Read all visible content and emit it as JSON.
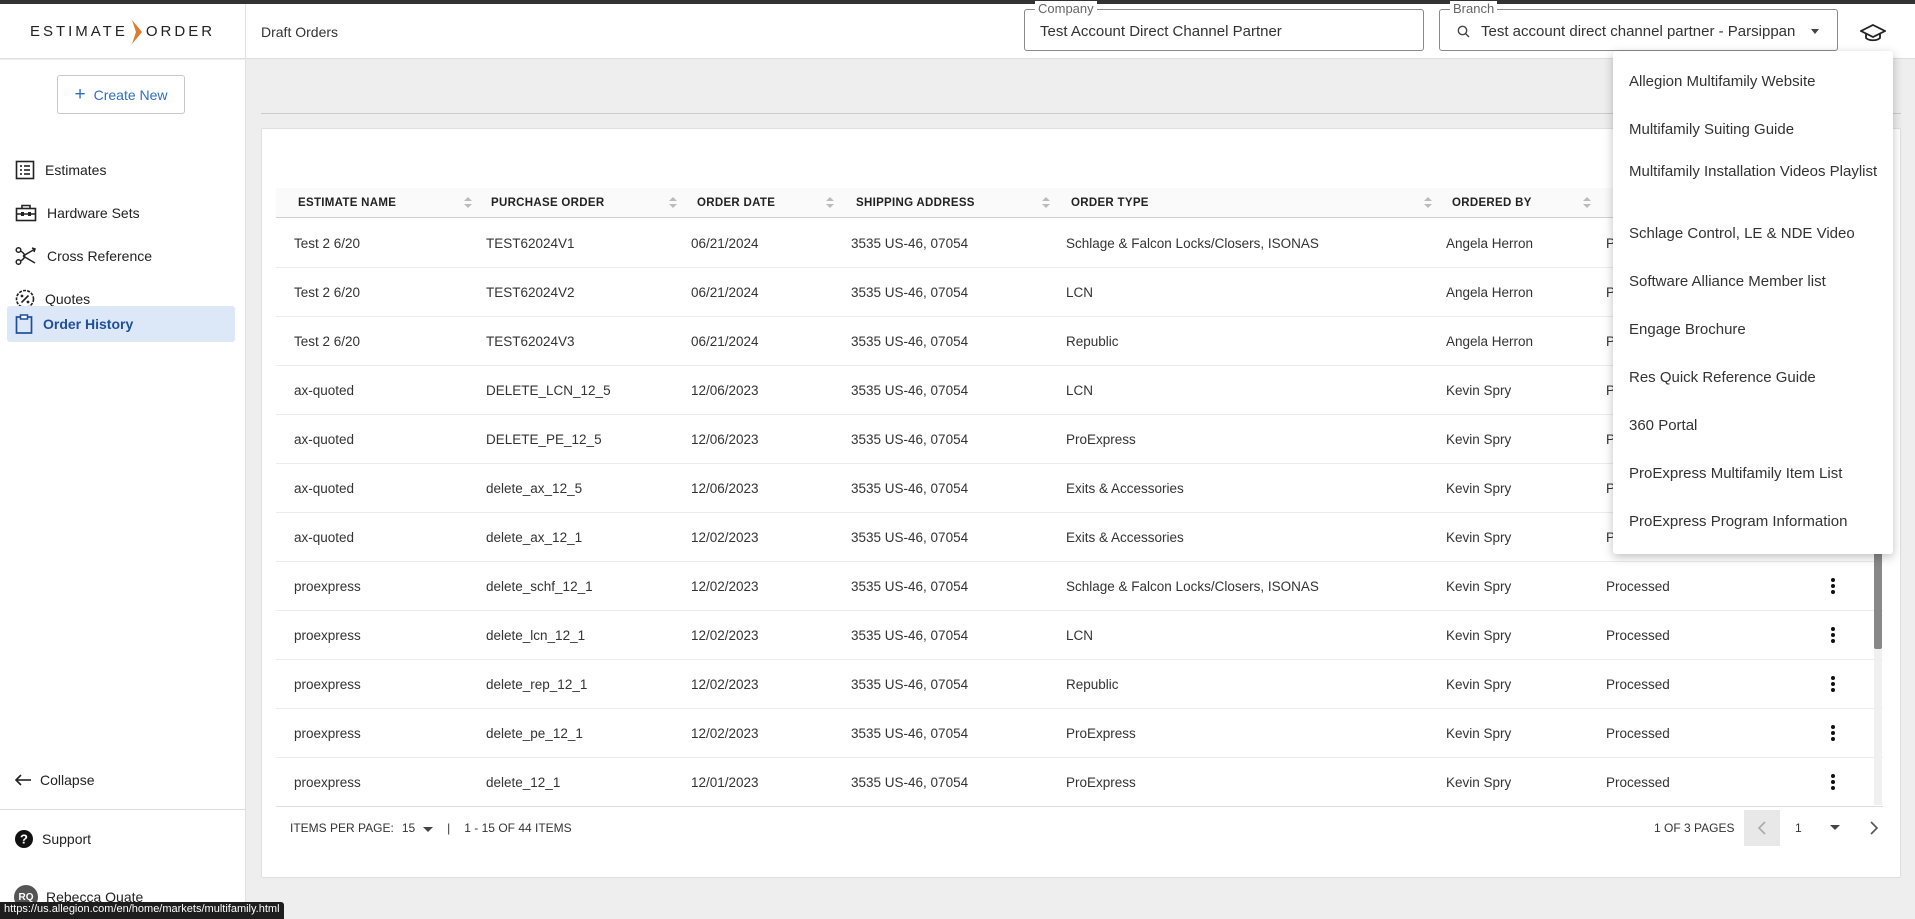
{
  "header": {
    "logo_left": "ESTIMATE",
    "logo_right": "ORDER",
    "page_title": "Draft Orders",
    "company": {
      "label": "Company",
      "value": "Test Account Direct Channel Partner"
    },
    "branch": {
      "label": "Branch",
      "value": "Test account direct channel partner - Parsippany"
    }
  },
  "sidebar": {
    "create_label": "Create New",
    "items": [
      {
        "label": "Estimates",
        "icon": "list-icon"
      },
      {
        "label": "Hardware Sets",
        "icon": "toolbox-icon"
      },
      {
        "label": "Cross Reference",
        "icon": "cross-reference-icon"
      },
      {
        "label": "Quotes",
        "icon": "percent-badge-icon"
      },
      {
        "label": "Order History",
        "icon": "clipboard-icon",
        "active": true
      }
    ],
    "collapse_label": "Collapse",
    "support_label": "Support",
    "user_initials": "RQ",
    "user_name": "Rebecca Quate"
  },
  "table": {
    "columns": [
      "ESTIMATE NAME",
      "PURCHASE ORDER",
      "ORDER DATE",
      "SHIPPING ADDRESS",
      "ORDER TYPE",
      "ORDERED BY"
    ],
    "rows": [
      [
        "Test 2 6/20",
        "TEST62024V1",
        "06/21/2024",
        "3535 US-46, 07054",
        "Schlage & Falcon Locks/Closers, ISONAS",
        "Angela Herron",
        "P"
      ],
      [
        "Test 2 6/20",
        "TEST62024V2",
        "06/21/2024",
        "3535 US-46, 07054",
        "LCN",
        "Angela Herron",
        "P"
      ],
      [
        "Test 2 6/20",
        "TEST62024V3",
        "06/21/2024",
        "3535 US-46, 07054",
        "Republic",
        "Angela Herron",
        "P"
      ],
      [
        "ax-quoted",
        "DELETE_LCN_12_5",
        "12/06/2023",
        "3535 US-46, 07054",
        "LCN",
        "Kevin Spry",
        "P"
      ],
      [
        "ax-quoted",
        "DELETE_PE_12_5",
        "12/06/2023",
        "3535 US-46, 07054",
        "ProExpress",
        "Kevin Spry",
        "P"
      ],
      [
        "ax-quoted",
        "delete_ax_12_5",
        "12/06/2023",
        "3535 US-46, 07054",
        "Exits & Accessories",
        "Kevin Spry",
        "P"
      ],
      [
        "ax-quoted",
        "delete_ax_12_1",
        "12/02/2023",
        "3535 US-46, 07054",
        "Exits & Accessories",
        "Kevin Spry",
        "P"
      ],
      [
        "proexpress",
        "delete_schf_12_1",
        "12/02/2023",
        "3535 US-46, 07054",
        "Schlage & Falcon Locks/Closers, ISONAS",
        "Kevin Spry",
        "Processed"
      ],
      [
        "proexpress",
        "delete_lcn_12_1",
        "12/02/2023",
        "3535 US-46, 07054",
        "LCN",
        "Kevin Spry",
        "Processed"
      ],
      [
        "proexpress",
        "delete_rep_12_1",
        "12/02/2023",
        "3535 US-46, 07054",
        "Republic",
        "Kevin Spry",
        "Processed"
      ],
      [
        "proexpress",
        "delete_pe_12_1",
        "12/02/2023",
        "3535 US-46, 07054",
        "ProExpress",
        "Kevin Spry",
        "Processed"
      ],
      [
        "proexpress",
        "delete_12_1",
        "12/01/2023",
        "3535 US-46, 07054",
        "ProExpress",
        "Kevin Spry",
        "Processed"
      ]
    ]
  },
  "pager": {
    "items_per_page_label": "ITEMS PER PAGE:",
    "items_per_page": "15",
    "separator": "|",
    "range": "1 - 15 OF 44 ITEMS",
    "pages": "1 OF 3 PAGES",
    "current_page": "1"
  },
  "menu": {
    "items": [
      "Allegion Multifamily Website",
      "Multifamily Suiting Guide",
      "Multifamily Installation Videos Playlist",
      "Schlage Control, LE & NDE Video",
      "Software Alliance Member list",
      "Engage Brochure",
      "Res Quick Reference Guide",
      "360 Portal",
      "ProExpress Multifamily Item List",
      "ProExpress Program Information"
    ]
  },
  "status_url": "https://us.allegion.com/en/home/markets/multifamily.html",
  "colors": {
    "accent": "#2f6fc0",
    "logo_chevron": "#e07a2a",
    "active_nav_bg": "#dce8f8"
  }
}
